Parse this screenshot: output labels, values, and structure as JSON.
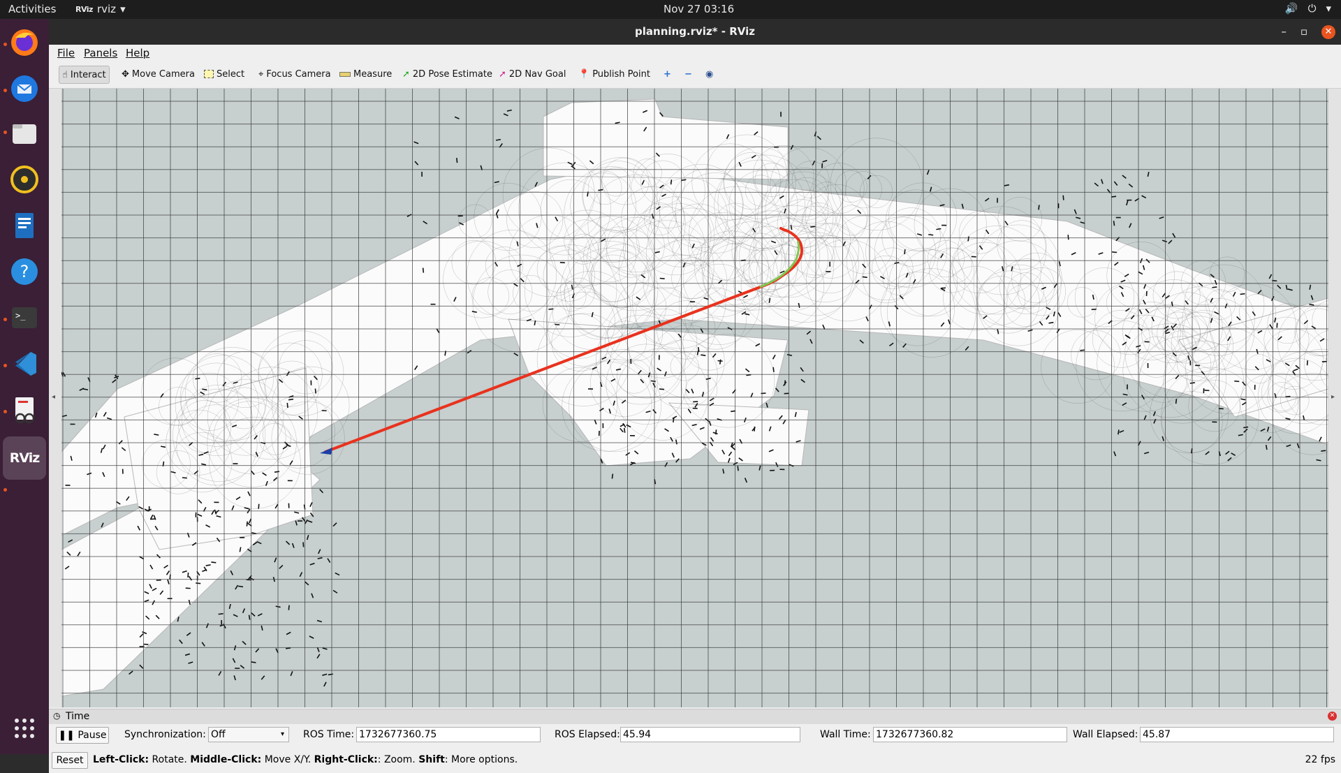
{
  "topbar": {
    "activities": "Activities",
    "app_name": "rviz",
    "app_logo": "RViz",
    "clock": "Nov 27  03:16"
  },
  "dock": {
    "items": [
      "firefox-icon",
      "thunderbird-icon",
      "files-icon",
      "rhythmbox-icon",
      "writer-icon",
      "help-icon",
      "terminal-icon",
      "vscode-icon",
      "document-viewer-icon",
      "rviz-icon",
      "app-grid-icon"
    ]
  },
  "window": {
    "title": "planning.rviz* - RViz"
  },
  "menu": {
    "file": "File",
    "panels": "Panels",
    "help": "Help"
  },
  "toolbar": {
    "interact": "Interact",
    "move_camera": "Move Camera",
    "select": "Select",
    "focus_camera": "Focus Camera",
    "measure": "Measure",
    "pose_estimate": "2D Pose Estimate",
    "nav_goal": "2D Nav Goal",
    "publish_point": "Publish Point"
  },
  "time_panel": {
    "title": "Time",
    "pause_label": "Pause",
    "sync_label": "Synchronization:",
    "sync_value": "Off",
    "ros_time_label": "ROS Time:",
    "ros_time": "1732677360.75",
    "ros_elapsed_label": "ROS Elapsed:",
    "ros_elapsed": "45.94",
    "wall_time_label": "Wall Time:",
    "wall_time": "1732677360.82",
    "wall_elapsed_label": "Wall Elapsed:",
    "wall_elapsed": "45.87"
  },
  "status": {
    "reset_label": "Reset",
    "lc": "Left-Click:",
    "lc_text": " Rotate. ",
    "mc": "Middle-Click:",
    "mc_text": " Move X/Y. ",
    "rc": "Right-Click:",
    "rc_text": ": Zoom. ",
    "shift": "Shift",
    "shift_text": ": More options.",
    "fps": "22 fps"
  },
  "colors": {
    "path_red": "#e8321e",
    "path_green": "#7ec850",
    "grid": "#3b3b3b",
    "map_free": "#ffffff",
    "background": "#c7cfcf"
  }
}
